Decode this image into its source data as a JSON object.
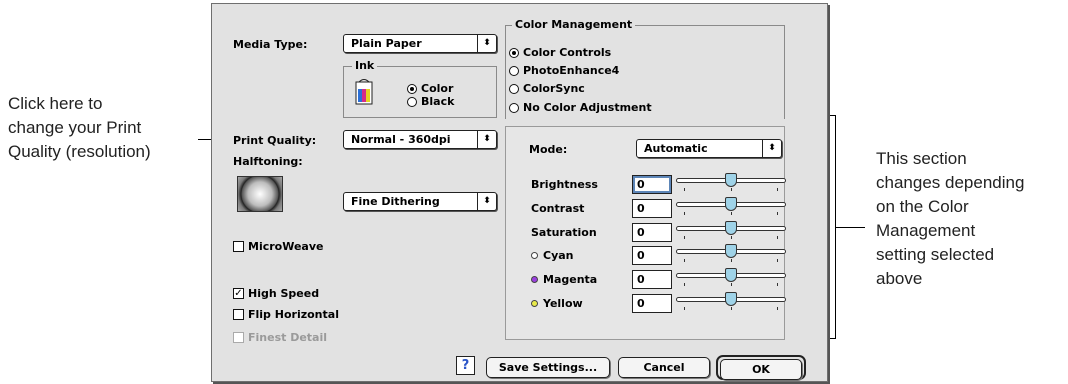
{
  "callouts": {
    "left": [
      "Click here to",
      "change your Print",
      "Quality (resolution)"
    ],
    "right": [
      "This section",
      "changes depending",
      "on the Color",
      "Management",
      "setting selected",
      "above"
    ]
  },
  "left": {
    "media_type_label": "Media Type:",
    "media_type_value": "Plain Paper",
    "ink_group_title": "Ink",
    "ink_options": [
      "Color",
      "Black"
    ],
    "print_quality_label": "Print Quality:",
    "print_quality_value": "Normal - 360dpi",
    "halftoning_label": "Halftoning:",
    "halftoning_value": "Fine Dithering",
    "microweave_label": "MicroWeave",
    "high_speed_label": "High Speed",
    "flip_horizontal_label": "Flip Horizontal",
    "finest_detail_label": "Finest Detail"
  },
  "color_management": {
    "title": "Color Management",
    "options": [
      "Color Controls",
      "PhotoEnhance4",
      "ColorSync",
      "No Color Adjustment"
    ],
    "mode_label": "Mode:",
    "mode_value": "Automatic",
    "sliders": [
      {
        "label": "Brightness",
        "value": "0"
      },
      {
        "label": "Contrast",
        "value": "0"
      },
      {
        "label": "Saturation",
        "value": "0"
      },
      {
        "label": "Cyan",
        "value": "0"
      },
      {
        "label": "Magenta",
        "value": "0"
      },
      {
        "label": "Yellow",
        "value": "0"
      }
    ]
  },
  "buttons": {
    "help": "?",
    "save_settings": "Save Settings...",
    "cancel": "Cancel",
    "ok": "OK"
  },
  "icons": {
    "popup_arrow": "⬍",
    "check_mark": "✓",
    "ink_cartridge": "ink-cartridge-icon"
  },
  "colors": {
    "cyan_dot": "#ffffff",
    "magenta_dot": "#9b3fe0",
    "yellow_dot": "#e8ea4a",
    "slider_thumb": "#9fd3e8"
  }
}
